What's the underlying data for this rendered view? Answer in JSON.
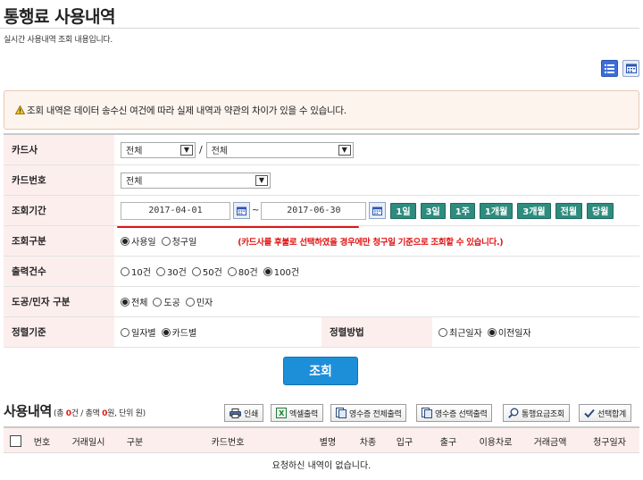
{
  "header": {
    "title": "통행료 사용내역",
    "subtitle": "실시간 사용내역 조회 내용입니다."
  },
  "notice": {
    "text": "조회 내역은 데이터 송수신 여건에 따라 실제 내역과 약관의 차이가 있을 수 있습니다."
  },
  "form": {
    "card_company": {
      "label": "카드사",
      "select1": "전체",
      "select2": "전체"
    },
    "card_number": {
      "label": "카드번호",
      "select": "전체"
    },
    "period": {
      "label": "조회기간",
      "start_date": "2017-04-01",
      "end_date": "2017-06-30",
      "tilde": "~",
      "quick_buttons": [
        "1일",
        "3일",
        "1주",
        "1개월",
        "3개월",
        "전월",
        "당월"
      ]
    },
    "search_type": {
      "label": "조회구분",
      "options": [
        "사용일",
        "청구일"
      ],
      "selected": "사용일",
      "note": "(카드사를 후불로 선택하였을 경우에만 청구일 기준으로 조회할 수 있습니다.)"
    },
    "output_count": {
      "label": "출력건수",
      "options": [
        "10건",
        "30건",
        "50건",
        "80건",
        "100건"
      ],
      "selected": "100건"
    },
    "road_type": {
      "label": "도공/민자 구분",
      "options": [
        "전체",
        "도공",
        "민자"
      ],
      "selected": "전체"
    },
    "sort_basis": {
      "label": "정렬기준",
      "options": [
        "일자별",
        "카드별"
      ],
      "selected": "카드별"
    },
    "sort_order": {
      "label": "정렬방법",
      "options": [
        "최근일자",
        "이전일자"
      ],
      "selected": "이전일자"
    },
    "search_label": "조회"
  },
  "results": {
    "title": "사용내역",
    "meta_prefix": "(총 ",
    "count": "0",
    "meta_mid": "건 / 총액 ",
    "amount": "0",
    "meta_suffix": "원, 단위 원)",
    "toolbar": {
      "print": "인쇄",
      "excel": "엑셀출력",
      "receipt_all": "영수증 전체출력",
      "receipt_selected": "영수증 선택출력",
      "toll_lookup": "통행요금조회",
      "select_all": "선택합계"
    },
    "columns": [
      "번호",
      "거래일시",
      "구분",
      "카드번호",
      "별명",
      "차종",
      "입구",
      "출구",
      "이용차로",
      "거래금액",
      "청구일자"
    ],
    "empty_message": "요청하신 내역이 없습니다."
  },
  "colors": {
    "label_bg": "#fdeeee",
    "period_btn": "#2e8c7e",
    "search_btn": "#1d8fd9",
    "note_red": "#e31414"
  }
}
